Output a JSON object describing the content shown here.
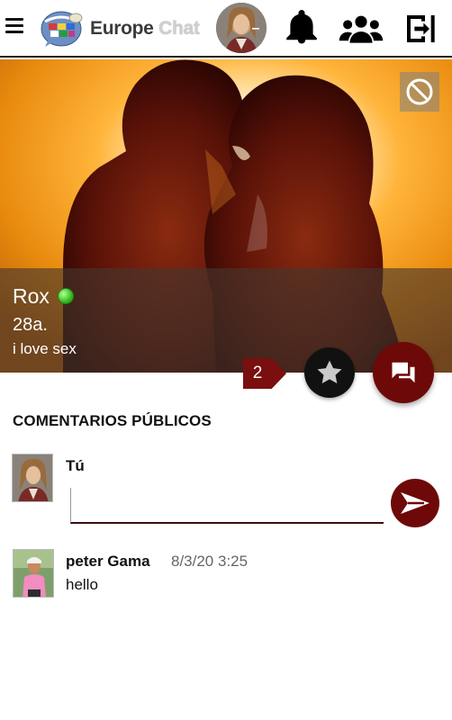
{
  "header": {
    "brand_main": "Europe",
    "brand_sub": "Chat",
    "icons": [
      "menu-icon",
      "globe-chat-logo",
      "user-avatar",
      "bell-icon",
      "users-icon",
      "logout-icon"
    ]
  },
  "profile": {
    "name": "Rox",
    "age": "28a.",
    "bio": "i love sex",
    "online": true,
    "online_color": "#2fbf1c",
    "favorites_count": "2"
  },
  "comments": {
    "section_title": "COMENTARIOS PÚBLICOS",
    "input": {
      "author": "Tú",
      "value": "",
      "placeholder": ""
    },
    "items": [
      {
        "author": "peter Gama",
        "date": "8/3/20 3:25",
        "text": "hello"
      }
    ]
  },
  "colors": {
    "accent": "#6e0909",
    "badge": "#7a0f0f",
    "hero_glow": "#f6a11a"
  }
}
